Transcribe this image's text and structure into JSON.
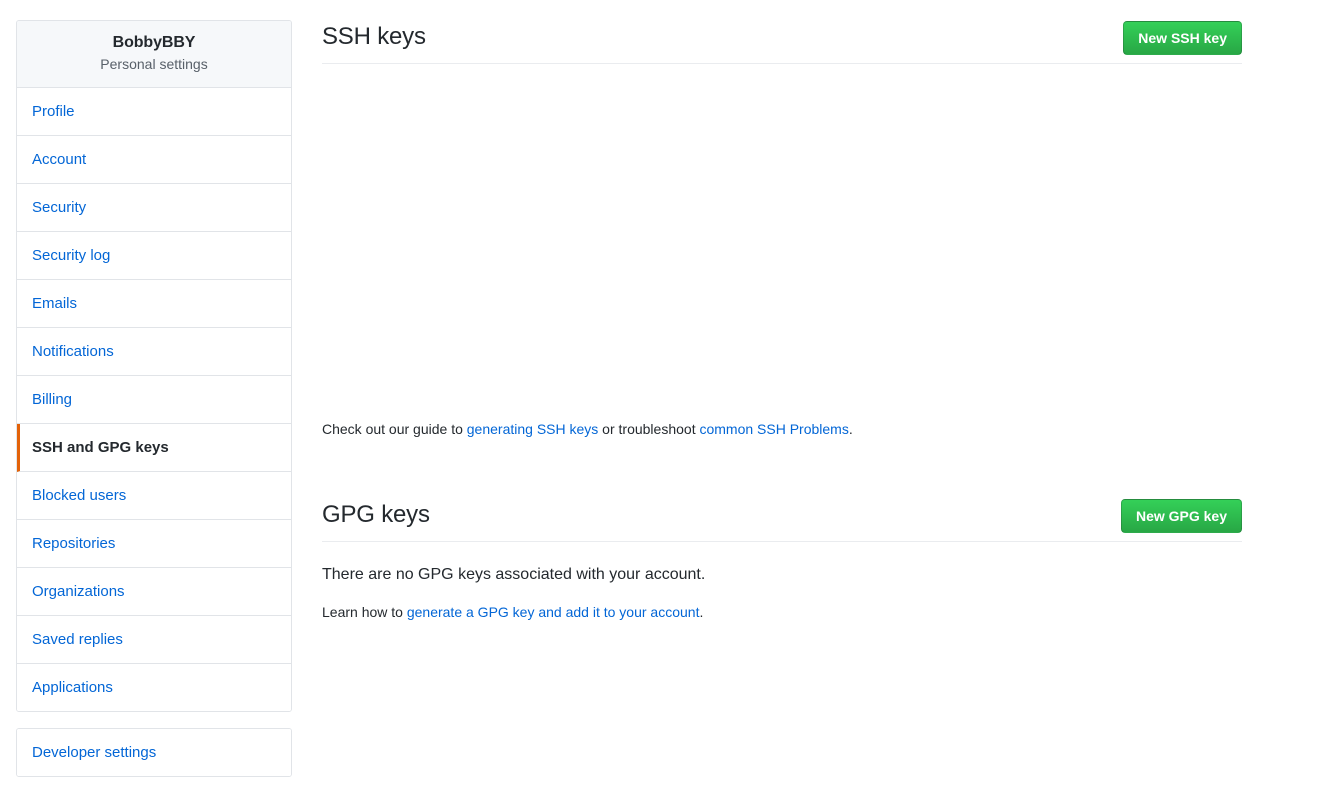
{
  "sidebar": {
    "header": {
      "username": "BobbyBBY",
      "subtitle": "Personal settings"
    },
    "items": [
      {
        "label": "Profile",
        "selected": false
      },
      {
        "label": "Account",
        "selected": false
      },
      {
        "label": "Security",
        "selected": false
      },
      {
        "label": "Security log",
        "selected": false
      },
      {
        "label": "Emails",
        "selected": false
      },
      {
        "label": "Notifications",
        "selected": false
      },
      {
        "label": "Billing",
        "selected": false
      },
      {
        "label": "SSH and GPG keys",
        "selected": true
      },
      {
        "label": "Blocked users",
        "selected": false
      },
      {
        "label": "Repositories",
        "selected": false
      },
      {
        "label": "Organizations",
        "selected": false
      },
      {
        "label": "Saved replies",
        "selected": false
      },
      {
        "label": "Applications",
        "selected": false
      }
    ],
    "developer_settings": {
      "label": "Developer settings"
    }
  },
  "ssh_section": {
    "title": "SSH keys",
    "new_key_button": "New SSH key",
    "keys": [],
    "guide": {
      "prefix": "Check out our guide to ",
      "link1": "generating SSH keys",
      "middle": " or troubleshoot ",
      "link2": "common SSH Problems",
      "suffix": "."
    }
  },
  "gpg_section": {
    "title": "GPG keys",
    "new_key_button": "New GPG key",
    "empty_message": "There are no GPG keys associated with your account.",
    "learn": {
      "prefix": "Learn how to ",
      "link": "generate a GPG key and add it to your account",
      "suffix": "."
    }
  },
  "colors": {
    "link": "#0366d6",
    "accent_selected": "#e36209",
    "button_green": "#2cbe4e",
    "text": "#24292e",
    "muted_text": "#586069",
    "border": "#e1e4e8"
  }
}
